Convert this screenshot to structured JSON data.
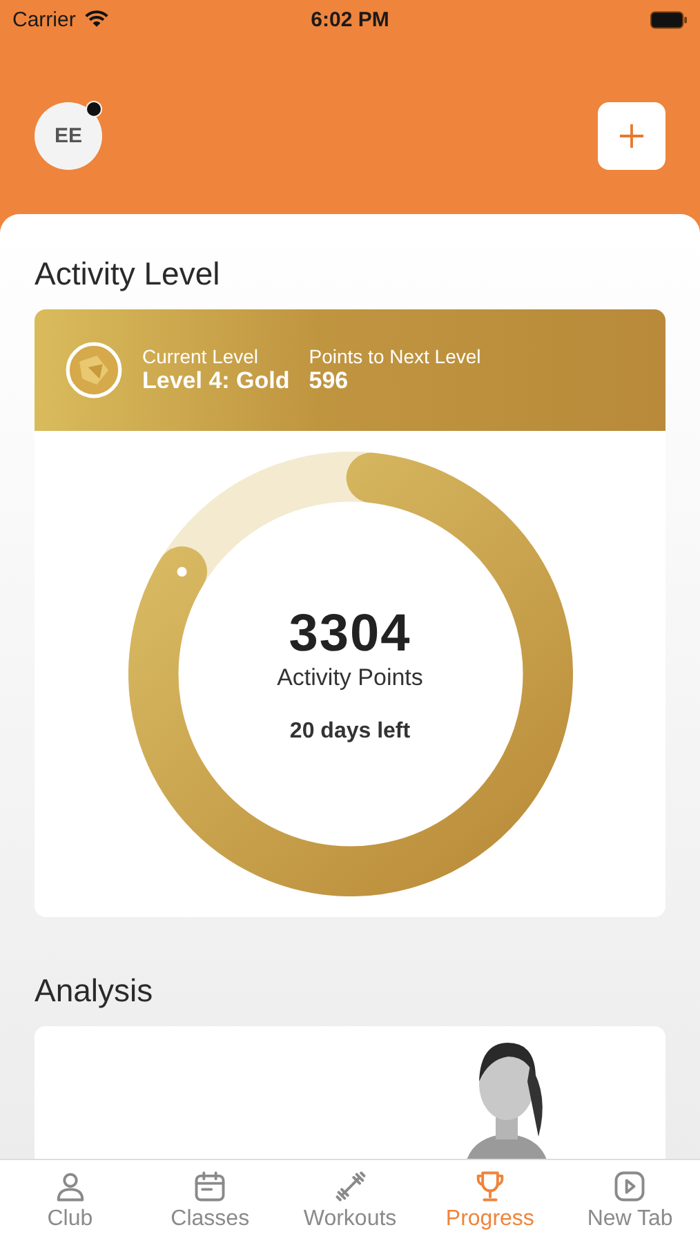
{
  "status_bar": {
    "carrier": "Carrier",
    "time": "6:02 PM"
  },
  "header": {
    "avatar_initials": "EE",
    "notification": true
  },
  "activity": {
    "title": "Activity Level",
    "current_label": "Current Level",
    "current_value": "Level 4: Gold",
    "next_label": "Points to Next Level",
    "next_value": "596",
    "points": "3304",
    "points_label": "Activity Points",
    "days_left": "20 days left"
  },
  "analysis": {
    "title": "Analysis",
    "kind": "picture"
  },
  "tabs": [
    {
      "label": "Club",
      "selected": false
    },
    {
      "label": "Classes",
      "selected": false
    },
    {
      "label": "Workouts",
      "selected": false
    },
    {
      "label": "Progress",
      "selected": true
    },
    {
      "label": "New Tab",
      "selected": false
    }
  ]
}
